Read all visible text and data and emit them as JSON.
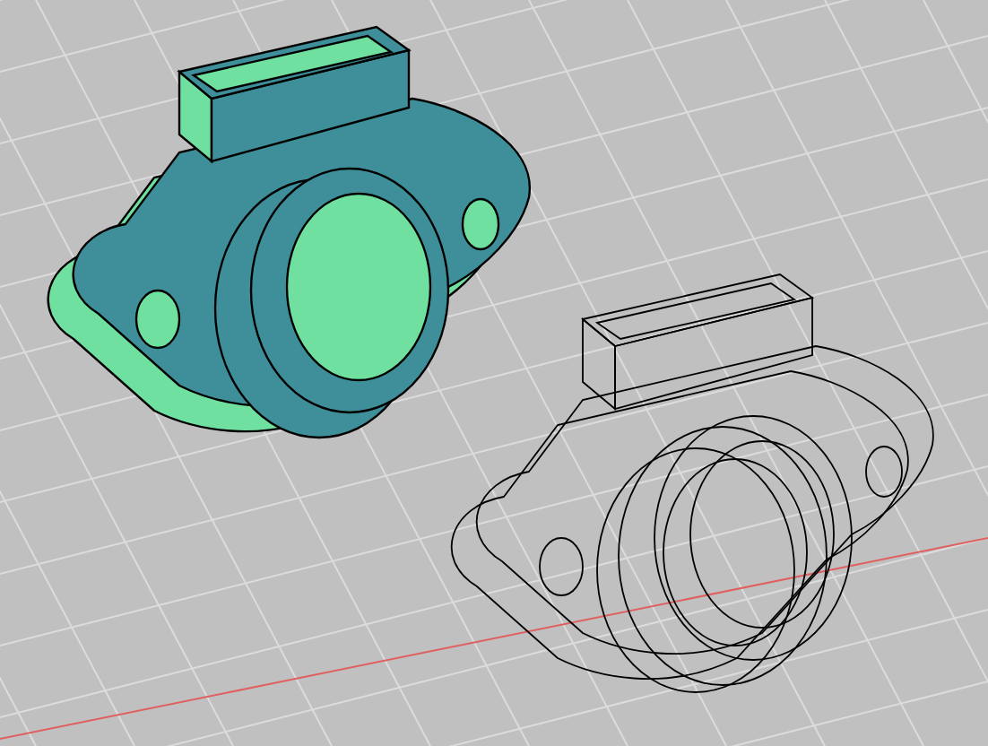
{
  "viewport": {
    "models": [
      {
        "kind": "shaded"
      },
      {
        "kind": "wireframe"
      }
    ]
  }
}
